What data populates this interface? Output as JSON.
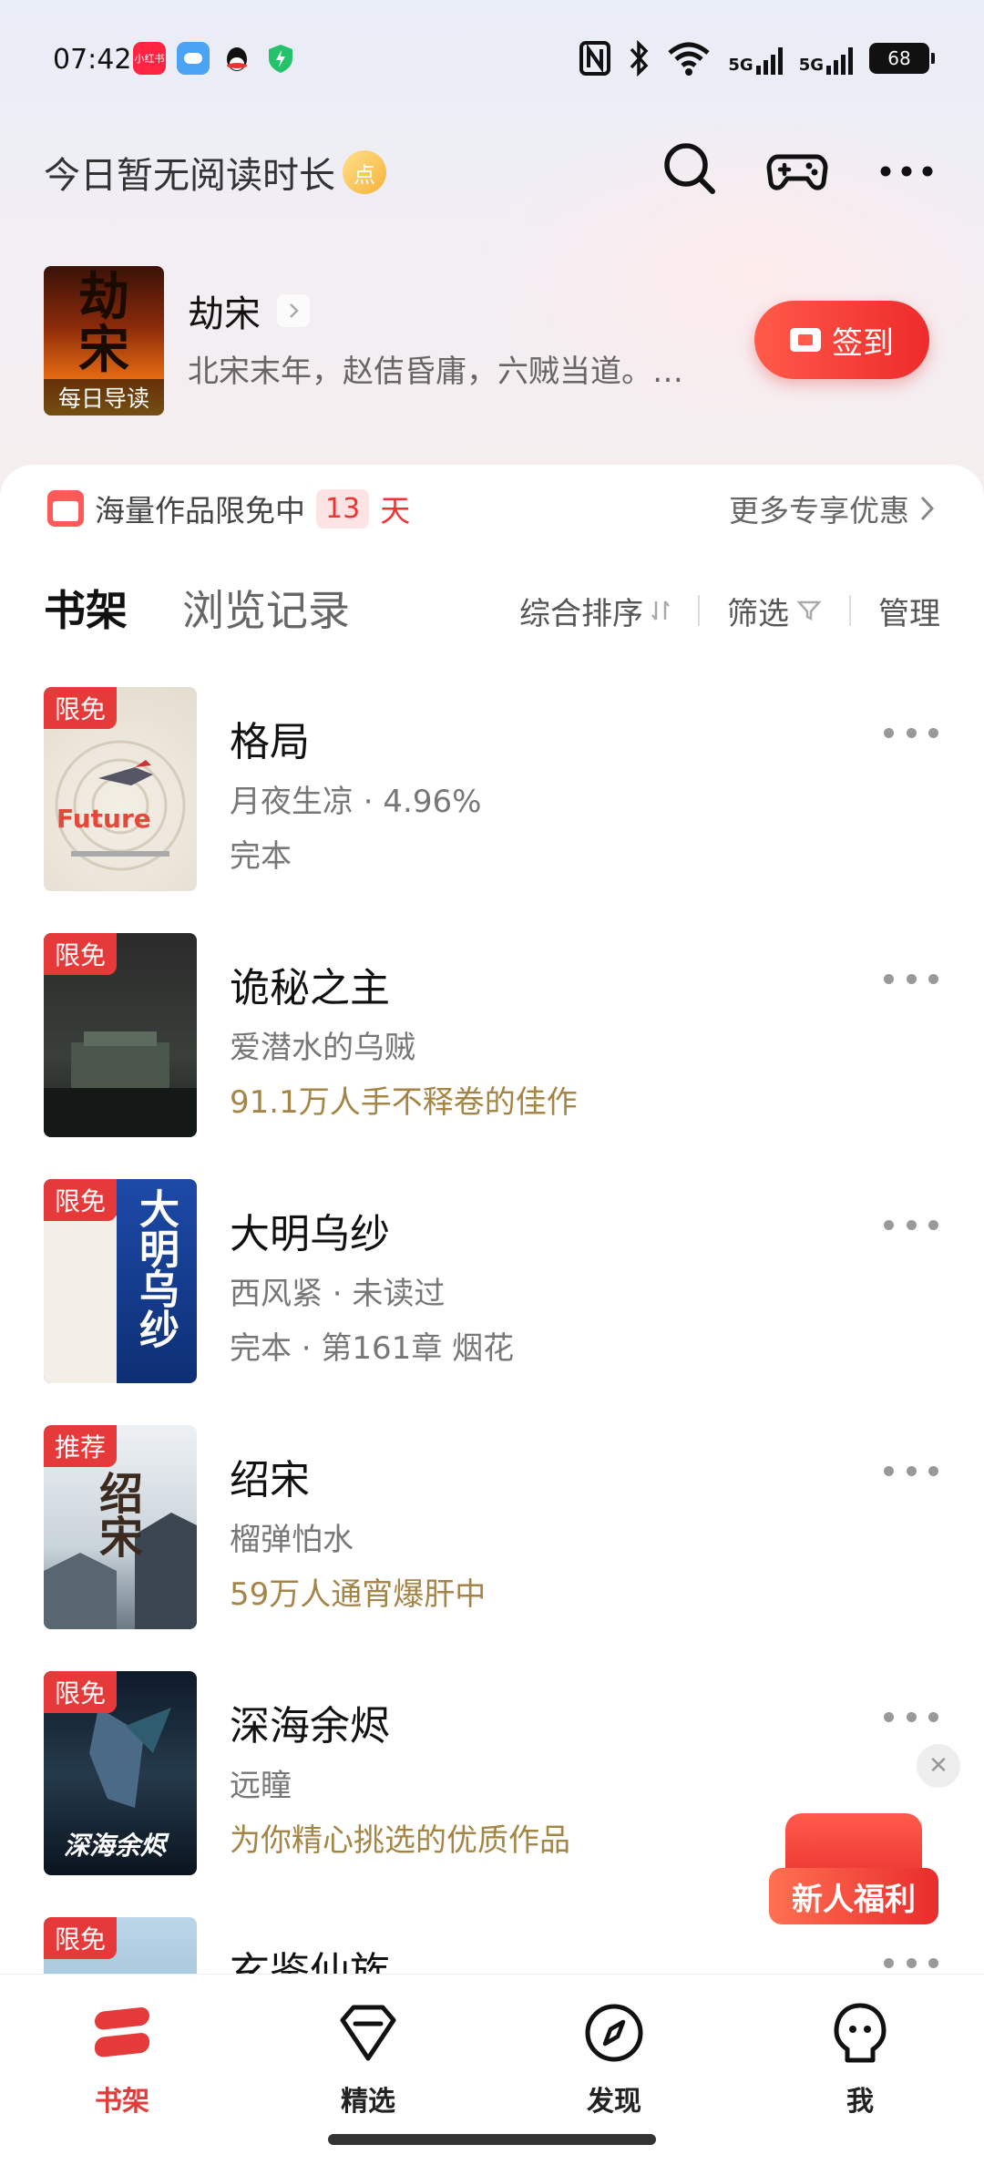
{
  "status_bar": {
    "time": "07:42",
    "app_icons": [
      "xiaohongshu-icon",
      "weather-icon",
      "qq-icon",
      "security-icon"
    ],
    "app_label_redbook": "小红书",
    "battery": "68",
    "net1": "5G",
    "net2": "5G"
  },
  "header": {
    "reading_status": "今日暂无阅读时长",
    "coin_glyph": "点",
    "icons": [
      "search-icon",
      "gamepad-icon",
      "more-icon"
    ]
  },
  "daily": {
    "cover_title": "劫宋",
    "cover_tag": "每日导读",
    "title": "劫宋",
    "description": "北宋末年，赵佶昏庸，六贼当道。…",
    "signin_label": "签到"
  },
  "promo": {
    "text": "海量作品限免中",
    "days": "13",
    "days_unit": "天",
    "more": "更多专享优惠"
  },
  "tabs": [
    {
      "label": "书架",
      "active": true
    },
    {
      "label": "浏览记录",
      "active": false
    }
  ],
  "tools": {
    "sort": "综合排序",
    "filter": "筛选",
    "manage": "管理"
  },
  "books": [
    {
      "title": "格局",
      "badge": "限免",
      "author": "月夜生凉 · 4.96%",
      "extra": "完本",
      "extra_style": "plain",
      "cover_text": "Future"
    },
    {
      "title": "诡秘之主",
      "badge": "限免",
      "author": "爱潜水的乌贼",
      "extra": "91.1万人手不释卷的佳作",
      "extra_style": "gold",
      "cover_text": ""
    },
    {
      "title": "大明乌纱",
      "badge": "限免",
      "author": "西风紧 · 未读过",
      "extra": "完本 · 第161章 烟花",
      "extra_style": "plain",
      "cover_text": "大明乌纱"
    },
    {
      "title": "绍宋",
      "badge": "推荐",
      "author": "榴弹怕水",
      "extra": "59万人通宵爆肝中",
      "extra_style": "gold",
      "cover_text": "绍宋"
    },
    {
      "title": "深海余烬",
      "badge": "限免",
      "author": "远瞳",
      "extra": "为你精心挑选的优质作品",
      "extra_style": "gold",
      "cover_text": "深海余烬"
    },
    {
      "title": "玄鉴仙族",
      "badge": "限免",
      "author": "",
      "extra": "",
      "extra_style": "plain",
      "cover_text": ""
    }
  ],
  "float": {
    "gift_label": "新人福利",
    "close_glyph": "✕"
  },
  "nav": [
    {
      "label": "书架",
      "icon": "bookshelf-icon",
      "active": true
    },
    {
      "label": "精选",
      "icon": "diamond-icon",
      "active": false
    },
    {
      "label": "发现",
      "icon": "compass-icon",
      "active": false
    },
    {
      "label": "我",
      "icon": "profile-icon",
      "active": false
    }
  ],
  "colors": {
    "accent": "#e63a3a",
    "gold_text": "#a48545",
    "secondary_text": "#777777"
  }
}
